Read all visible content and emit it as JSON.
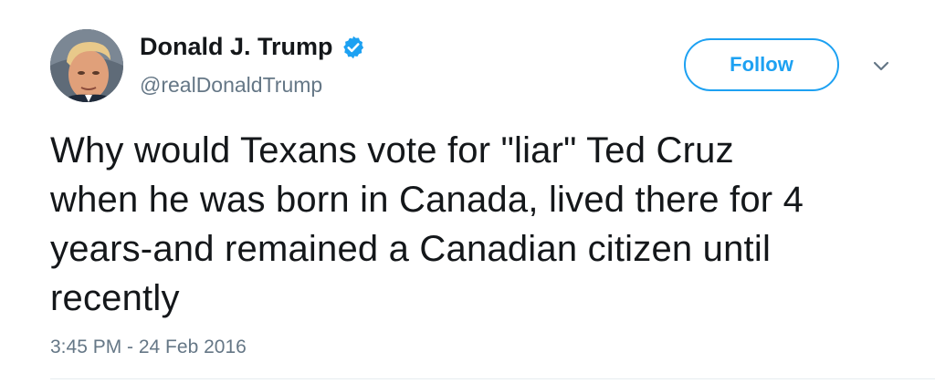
{
  "user": {
    "display_name": "Donald J. Trump",
    "handle": "@realDonaldTrump",
    "verified": true
  },
  "actions": {
    "follow_label": "Follow"
  },
  "tweet": {
    "text_lines": [
      "Why would Texans vote for \"liar\" Ted Cruz",
      "when he was born in Canada, lived there for 4",
      "years-and remained a Canadian citizen until",
      "recently"
    ],
    "timestamp": "3:45 PM - 24 Feb 2016"
  },
  "icons": {
    "verified": "verified-badge-icon",
    "more": "chevron-down-icon"
  },
  "colors": {
    "accent": "#1da1f2",
    "text_primary": "#14171a",
    "text_secondary": "#657786",
    "divider": "#e6ecf0"
  }
}
